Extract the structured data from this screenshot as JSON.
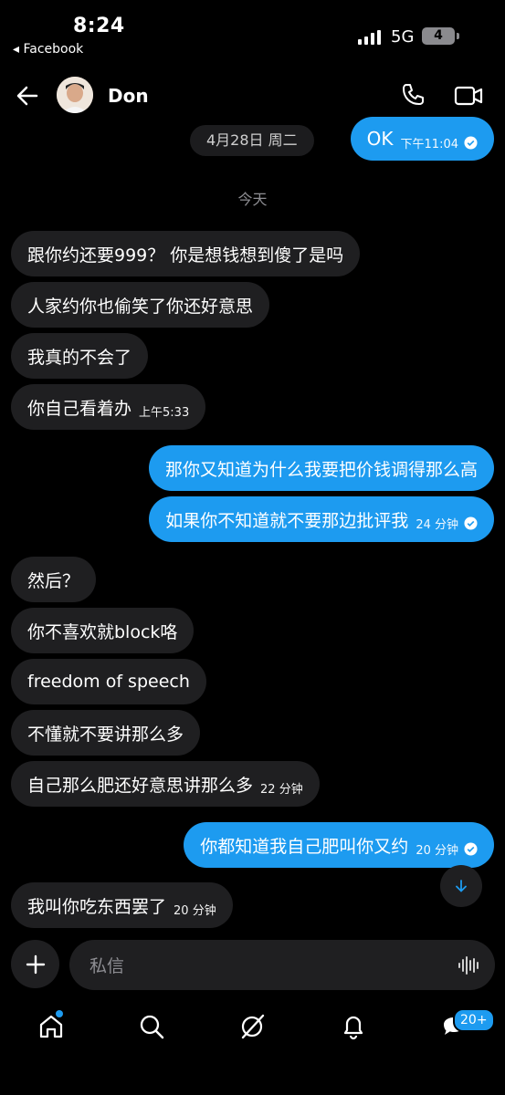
{
  "status": {
    "time": "8:24",
    "back_app": "◂ Facebook",
    "network": "5G",
    "battery": "4"
  },
  "header": {
    "name": "Don"
  },
  "date_pill": "4月28日 周二",
  "today_label": "今天",
  "messages": [
    {
      "dir": "out",
      "text": "OK",
      "time": "下午11:04"
    },
    {
      "dir": "in",
      "text": "跟你约还要999？ 你是想钱想到傻了是吗",
      "time": ""
    },
    {
      "dir": "in",
      "text": "人家约你也偷笑了你还好意思",
      "time": ""
    },
    {
      "dir": "in",
      "text": "我真的不会了",
      "time": ""
    },
    {
      "dir": "in",
      "text": "你自己看着办",
      "time": "上午5:33"
    },
    {
      "dir": "out",
      "text": "那你又知道为什么我要把价钱调得那么高",
      "time": ""
    },
    {
      "dir": "out",
      "text": "如果你不知道就不要那边批评我",
      "time": "24 分钟"
    },
    {
      "dir": "in",
      "text": "然后？",
      "time": ""
    },
    {
      "dir": "in",
      "text": "你不喜欢就block咯",
      "time": ""
    },
    {
      "dir": "in",
      "text": "freedom of speech",
      "time": ""
    },
    {
      "dir": "in",
      "text": "不懂就不要讲那么多",
      "time": ""
    },
    {
      "dir": "in",
      "text": "自己那么肥还好意思讲那么多",
      "time": "22 分钟"
    },
    {
      "dir": "out",
      "text": "你都知道我自己肥叫你又约",
      "time": "20 分钟"
    },
    {
      "dir": "in",
      "text": "我叫你吃东西罢了",
      "time": "20 分钟"
    }
  ],
  "composer": {
    "placeholder": "私信"
  },
  "nav": {
    "messages_badge": "20+"
  },
  "colors": {
    "accent": "#1d9bf0",
    "incoming_bubble": "#1f1f21",
    "background": "#000000"
  }
}
